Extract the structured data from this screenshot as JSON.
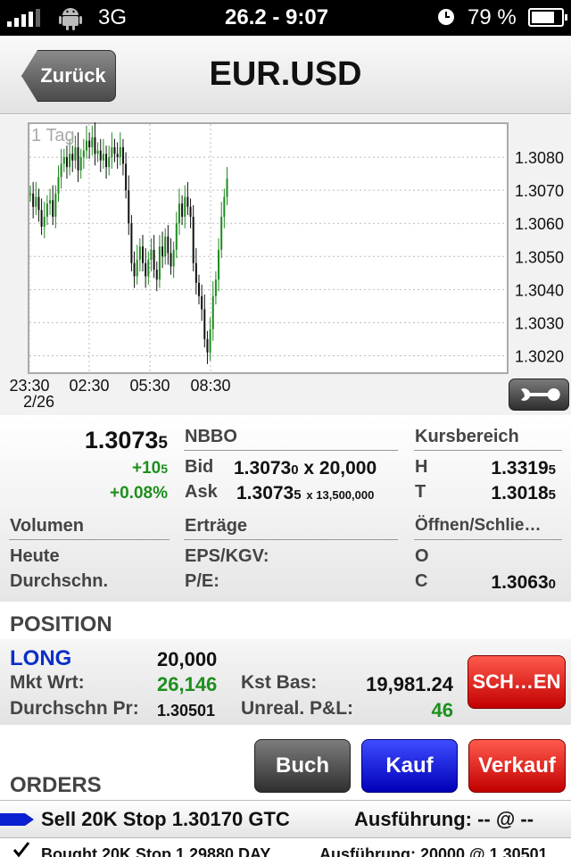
{
  "status_bar": {
    "carrier": "3G",
    "datetime": "26.2 - 9:07",
    "battery": "79 %",
    "battery_level": 0.79
  },
  "navbar": {
    "back_label": "Zurück",
    "title": "EUR.USD"
  },
  "chart": {
    "period_label": "1 Tag",
    "y_ticks": [
      "1.3080",
      "1.3070",
      "1.3060",
      "1.3050",
      "1.3040",
      "1.3030",
      "1.3020"
    ],
    "x_ticks": [
      "23:30",
      "02:30",
      "05:30",
      "08:30"
    ],
    "date_label": "2/26"
  },
  "chart_data": {
    "type": "candlestick",
    "title": "",
    "period": "1 Tag",
    "x_ticks": [
      "23:30",
      "02:30",
      "05:30",
      "08:30"
    ],
    "ylim": [
      1.3015,
      1.309
    ],
    "series": [
      {
        "values": [
          1.3069,
          1.3065,
          1.3068,
          1.3064,
          1.3059,
          1.3062,
          1.3066,
          1.3067,
          1.3062,
          1.3069,
          1.3074,
          1.3078,
          1.308,
          1.3077,
          1.3081,
          1.3079,
          1.3083,
          1.3076,
          1.308,
          1.3082,
          1.3085,
          1.3083,
          1.3086,
          1.3081,
          1.3082,
          1.3079,
          1.3081,
          1.3077,
          1.308,
          1.3083,
          1.3081,
          1.308,
          1.3083,
          1.3078,
          1.307,
          1.306,
          1.3048,
          1.3044,
          1.3049,
          1.3053,
          1.3048,
          1.3044,
          1.3049,
          1.3052,
          1.3046,
          1.3043,
          1.3053,
          1.305,
          1.3056,
          1.3051,
          1.3047,
          1.3052,
          1.306,
          1.3066,
          1.3062,
          1.3068,
          1.3065,
          1.3062,
          1.3048,
          1.3042,
          1.3038,
          1.3034,
          1.3025,
          1.3021,
          1.3028,
          1.3038,
          1.3043,
          1.3052,
          1.3062,
          1.3068,
          1.30735
        ]
      }
    ]
  },
  "quote": {
    "last_main": "1.3073",
    "last_sub": "5",
    "change_main": "+10",
    "change_sub": "5",
    "change_pct": "+0.08%",
    "nbbo_label": "NBBO",
    "bid_label": "Bid",
    "bid_main": "1.3073",
    "bid_sub": "0",
    "bid_size": "x 20,000",
    "ask_label": "Ask",
    "ask_main": "1.3073",
    "ask_sub": "5",
    "ask_size": "x 13,500,000",
    "range_label": "Kursbereich",
    "high_label": "H",
    "high_main": "1.3319",
    "high_sub": "5",
    "low_label": "T",
    "low_main": "1.3018",
    "low_sub": "5",
    "volume_label": "Volumen",
    "today_label": "Heute",
    "avg_label": "Durchschn.",
    "earnings_label": "Erträge",
    "eps_label": "EPS/KGV:",
    "pe_label": "P/E:",
    "open_close_label": "Öffnen/Schlie…",
    "open_label": "O",
    "close_label": "C",
    "close_main": "1.3063",
    "close_sub": "0"
  },
  "position": {
    "section_title": "POSITION",
    "side": "LONG",
    "quantity": "20,000",
    "mkt_value_label": "Mkt Wrt:",
    "mkt_value": "26,146",
    "avg_price_label": "Durchschn Pr:",
    "avg_price": "1.30501",
    "cost_basis_label": "Kst Bas:",
    "cost_basis": "19,981.24",
    "unreal_label": "Unreal. P&L:",
    "unreal_value": "46",
    "close_button": "SCH…EN"
  },
  "orders": {
    "section_title": "ORDERS",
    "book_button": "Buch",
    "buy_button": "Kauf",
    "sell_button": "Verkauf",
    "rows": [
      {
        "text": "Sell 20K Stop 1.30170 GTC",
        "exec": "Ausführung: -- @ --"
      },
      {
        "text": "Bought 20K Stop 1.29880 DAY",
        "exec": "Ausführung: 20000 @ 1.30501"
      }
    ]
  },
  "colors": {
    "bull": "#1f8a1f",
    "bear": "#111111",
    "accent_blue": "#0a2fc8",
    "red": "#c20000"
  }
}
